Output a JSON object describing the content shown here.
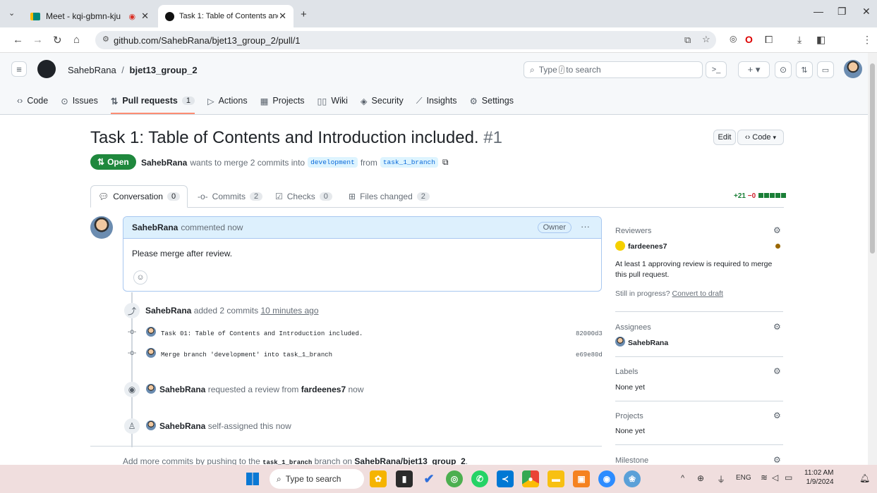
{
  "browser": {
    "tabs": [
      {
        "label": "Meet - kqi-gbmn-kju"
      },
      {
        "label": "Task 1: Table of Contents and In"
      }
    ],
    "url": "github.com/SahebRana/bjet13_group_2/pull/1"
  },
  "github": {
    "owner": "SahebRana",
    "separator": "/",
    "repo": "bjet13_group_2",
    "search_placeholder": "Type / to search",
    "search_prefix": "Type",
    "search_key": "/",
    "search_suffix": "to search",
    "nav": [
      {
        "label": "Code",
        "icon": "code-icon"
      },
      {
        "label": "Issues",
        "icon": "issue-icon"
      },
      {
        "label": "Pull requests",
        "count": "1",
        "icon": "pull-request-icon"
      },
      {
        "label": "Actions",
        "icon": "actions-icon"
      },
      {
        "label": "Projects",
        "icon": "projects-icon"
      },
      {
        "label": "Wiki",
        "icon": "wiki-icon"
      },
      {
        "label": "Security",
        "icon": "shield-icon"
      },
      {
        "label": "Insights",
        "icon": "graph-icon"
      },
      {
        "label": "Settings",
        "icon": "gear-icon"
      }
    ]
  },
  "pr": {
    "title": "Task 1: Table of Contents and Introduction included.",
    "number": "#1",
    "edit_label": "Edit",
    "code_label": "Code",
    "state": "Open",
    "author": "SahebRana",
    "merge_text": "wants to merge 2 commits into",
    "base_branch": "development",
    "from_text": "from",
    "head_branch": "task_1_branch",
    "tabs": [
      {
        "label": "Conversation",
        "count": "0"
      },
      {
        "label": "Commits",
        "count": "2"
      },
      {
        "label": "Checks",
        "count": "0"
      },
      {
        "label": "Files changed",
        "count": "2"
      }
    ],
    "additions": "+21",
    "deletions": "−0"
  },
  "comment": {
    "author": "SahebRana",
    "meta": "commented now",
    "role": "Owner",
    "body": "Please merge after review."
  },
  "timeline": {
    "commits_event_author": "SahebRana",
    "commits_event_text": "added 2 commits",
    "commits_event_time": "10 minutes ago",
    "commits": [
      {
        "message": "Task 01: Table of Contents and Introduction included.",
        "sha": "82000d3"
      },
      {
        "message": "Merge branch 'development' into task_1_branch",
        "sha": "e69e80d"
      }
    ],
    "review_author": "SahebRana",
    "review_text": "requested a review from",
    "review_target": "fardeenes7",
    "review_time": "now",
    "assign_author": "SahebRana",
    "assign_text": "self-assigned this now",
    "footer_prefix": "Add more commits by pushing to the",
    "footer_branch": "task_1_branch",
    "footer_mid": "branch on",
    "footer_repo": "SahebRana/bjet13_group_2",
    "footer_end": "."
  },
  "sidebar": {
    "reviewers_label": "Reviewers",
    "reviewer": "fardeenes7",
    "review_note": "At least 1 approving review is required to merge this pull request.",
    "draft_prefix": "Still in progress?",
    "draft_link": "Convert to draft",
    "assignees_label": "Assignees",
    "assignee": "SahebRana",
    "labels_label": "Labels",
    "labels_value": "None yet",
    "projects_label": "Projects",
    "projects_value": "None yet",
    "milestone_label": "Milestone"
  },
  "taskbar": {
    "search_placeholder": "Type to search",
    "lang": "ENG",
    "time": "11:02 AM",
    "date": "1/9/2024"
  },
  "colors": {
    "open_green": "#1f883d",
    "link_blue": "#0969da",
    "comment_header": "#ddf0fd"
  }
}
